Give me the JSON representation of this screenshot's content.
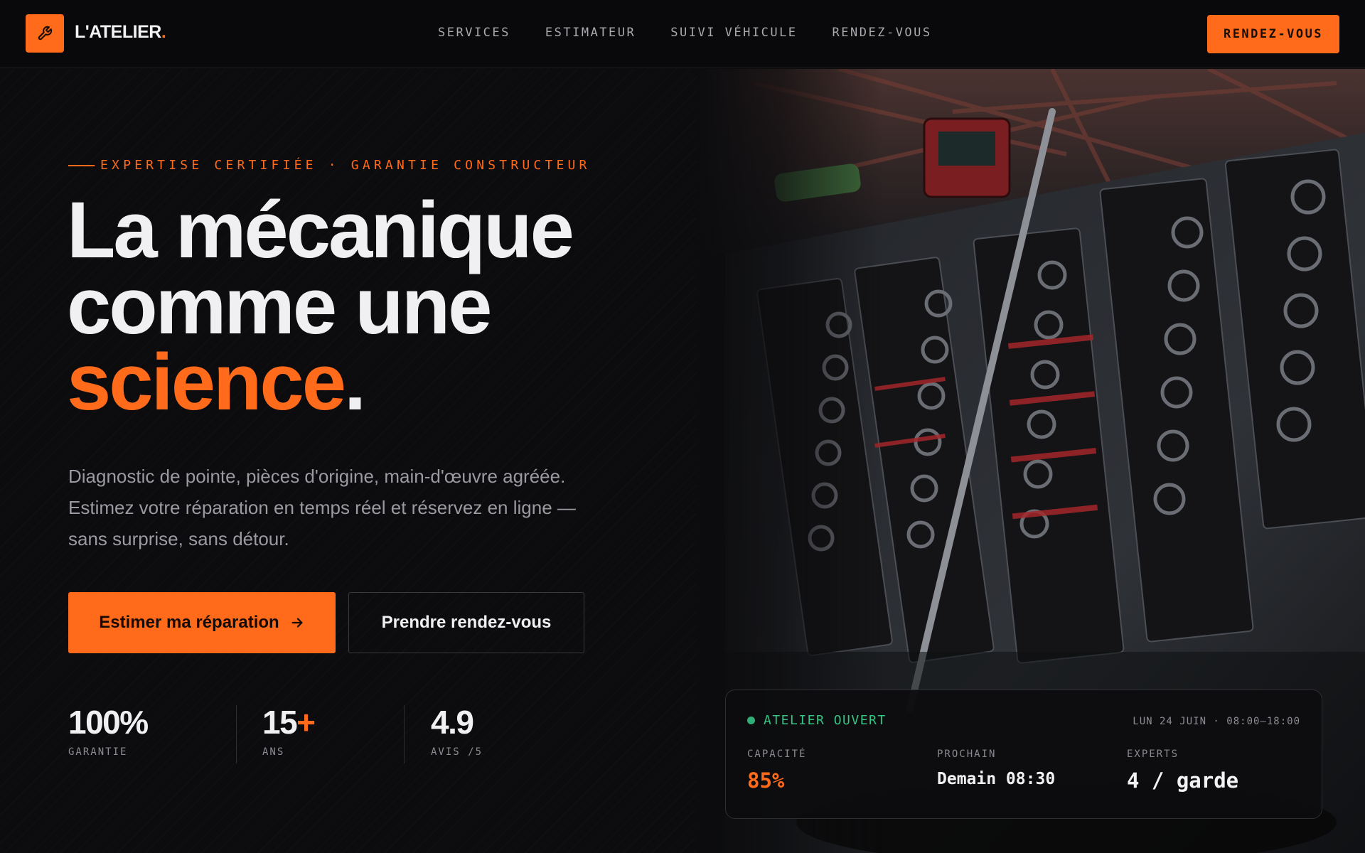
{
  "brand": {
    "name": "L'ATELIER",
    "dot": ".",
    "logo_icon": "wrench-icon",
    "accent_color": "#ff6b1a"
  },
  "nav": {
    "links": [
      "SERVICES",
      "ESTIMATEUR",
      "SUIVI VÉHICULE",
      "RENDEZ-VOUS"
    ],
    "cta_label": "RENDEZ-VOUS"
  },
  "hero": {
    "eyebrow": "EXPERTISE CERTIFIÉE · GARANTIE CONSTRUCTEUR",
    "headline_line1": "La mécanique",
    "headline_line2": "comme une",
    "headline_accent": "science",
    "headline_end": ".",
    "lead": "Diagnostic de pointe, pièces d'origine, main-d'œuvre agréée. Estimez votre réparation en temps réel et réservez en ligne — sans surprise, sans détour.",
    "primary_button": "Estimer ma réparation",
    "primary_button_icon": "arrow-right-icon",
    "secondary_button": "Prendre rendez-vous"
  },
  "stats": [
    {
      "value": "100%",
      "suffix": "",
      "label": "GARANTIE"
    },
    {
      "value": "15",
      "suffix": "+",
      "label": "ANS"
    },
    {
      "value": "4.9",
      "suffix": "",
      "label": "AVIS /5"
    }
  ],
  "status_card": {
    "status": "ATELIER OUVERT",
    "status_color": "#2faf75",
    "hours": "LUN 24 JUIN · 08:00–18:00",
    "metrics": [
      {
        "label": "CAPACITÉ",
        "value": "85%"
      },
      {
        "label": "PROCHAIN",
        "value": "Demain 08:30"
      },
      {
        "label": "EXPERTS",
        "value": "4 / garde"
      }
    ]
  }
}
